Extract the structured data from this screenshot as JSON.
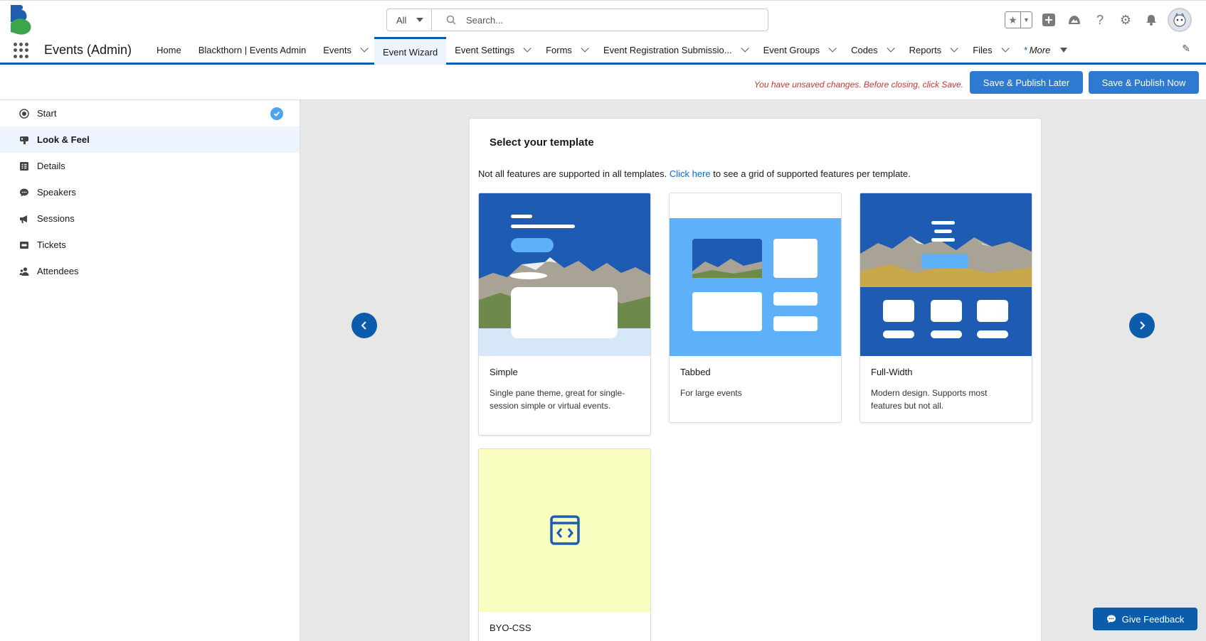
{
  "header": {
    "search_scope": "All",
    "search_placeholder": "Search..."
  },
  "nav": {
    "app_name": "Events (Admin)",
    "items": [
      {
        "label": "Home",
        "dropdown": false
      },
      {
        "label": "Blackthorn | Events Admin",
        "dropdown": false
      },
      {
        "label": "Events",
        "dropdown": true
      },
      {
        "label": "Event Wizard",
        "dropdown": false,
        "active": true
      },
      {
        "label": "Event Settings",
        "dropdown": true
      },
      {
        "label": "Forms",
        "dropdown": true
      },
      {
        "label": "Event Registration Submissio...",
        "dropdown": true
      },
      {
        "label": "Event Groups",
        "dropdown": true
      },
      {
        "label": "Codes",
        "dropdown": true
      },
      {
        "label": "Reports",
        "dropdown": true
      },
      {
        "label": "Files",
        "dropdown": true
      }
    ],
    "more_label": "More",
    "more_marker": "*"
  },
  "actions": {
    "unsaved_message": "You have unsaved changes. Before closing, click Save.",
    "publish_later": "Save & Publish Later",
    "publish_now": "Save & Publish Now"
  },
  "sidebar": {
    "steps": [
      {
        "label": "Start",
        "icon": "target-icon",
        "done": true
      },
      {
        "label": "Look & Feel",
        "icon": "palette-icon",
        "active": true
      },
      {
        "label": "Details",
        "icon": "list-icon"
      },
      {
        "label": "Speakers",
        "icon": "chat-icon"
      },
      {
        "label": "Sessions",
        "icon": "megaphone-icon"
      },
      {
        "label": "Tickets",
        "icon": "ticket-icon"
      },
      {
        "label": "Attendees",
        "icon": "people-icon"
      }
    ]
  },
  "template_panel": {
    "title": "Select your template",
    "note_before": "Not all features are supported in all templates.",
    "note_link": "Click here",
    "note_after": "to see a grid of supported features per template.",
    "templates": [
      {
        "name": "Simple",
        "description": "Single pane theme, great for single-session simple or virtual events."
      },
      {
        "name": "Tabbed",
        "description": "For large events"
      },
      {
        "name": "Full-Width",
        "description": "Modern design. Supports most features but not all."
      },
      {
        "name": "BYO-CSS",
        "description": ""
      }
    ]
  },
  "feedback_label": "Give Feedback",
  "colors": {
    "brand_blue": "#0b5cab",
    "button_blue": "#2e7ad1",
    "error_red": "#c23934",
    "byo_bg": "#f9fdbf"
  }
}
